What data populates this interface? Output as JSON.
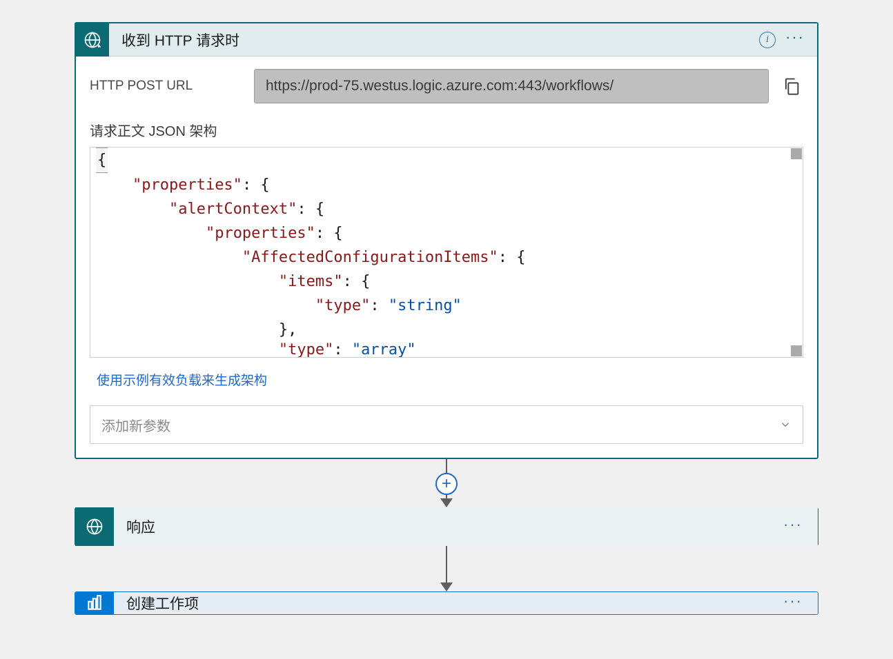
{
  "trigger": {
    "title": "收到 HTTP 请求时",
    "url_label": "HTTP POST URL",
    "url_value": "https://prod-75.westus.logic.azure.com:443/workflows/",
    "schema_label": "请求正文 JSON 架构",
    "code": {
      "l1": "{",
      "l2_key": "\"properties\"",
      "l2_colon": ": {",
      "l3_key": "\"alertContext\"",
      "l3_colon": ": {",
      "l4_key": "\"properties\"",
      "l4_colon": ": {",
      "l5_key": "\"AffectedConfigurationItems\"",
      "l5_colon": ": {",
      "l6_key": "\"items\"",
      "l6_colon": ": {",
      "l7_key": "\"type\"",
      "l7_colon": ": ",
      "l7_val": "\"string\"",
      "l8": "},",
      "l9_key": "\"type\"",
      "l9_colon": ": ",
      "l9_val": "\"array\""
    },
    "sample_link": "使用示例有效负载来生成架构",
    "param_placeholder": "添加新参数"
  },
  "step_response": {
    "title": "响应"
  },
  "step_workitem": {
    "title": "创建工作项"
  },
  "info_glyph": "i",
  "plus_glyph": "+"
}
